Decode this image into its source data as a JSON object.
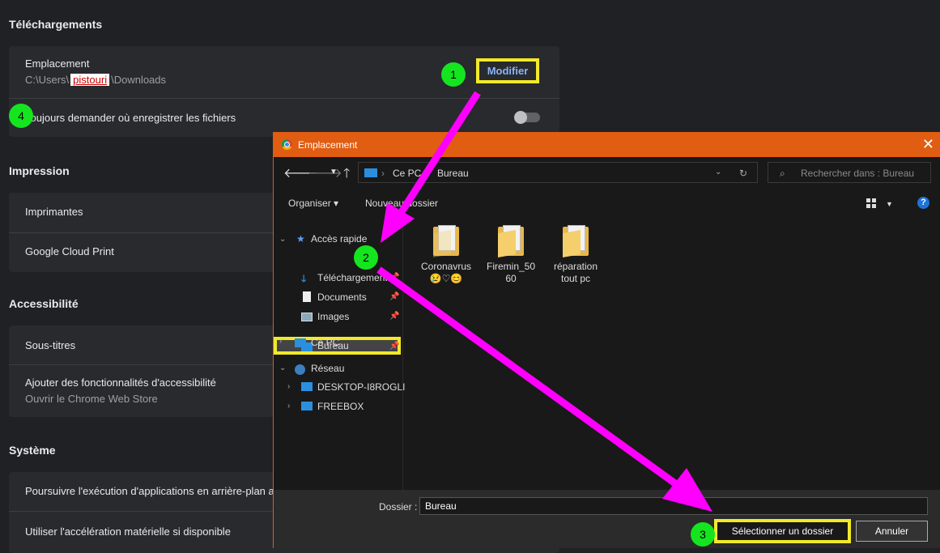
{
  "settings": {
    "downloads": {
      "title": "Téléchargements",
      "location_label": "Emplacement",
      "path_prefix": "C:\\Users\\",
      "path_user": "pistouri",
      "path_suffix": "\\Downloads",
      "modify_button": "Modifier",
      "ask_label": "Toujours demander où enregistrer les fichiers",
      "ask_toggle_on": false
    },
    "printing": {
      "title": "Impression",
      "items": [
        "Imprimantes",
        "Google Cloud Print"
      ]
    },
    "accessibility": {
      "title": "Accessibilité",
      "captions": "Sous-titres",
      "add_features": "Ajouter des fonctionnalités d'accessibilité",
      "add_features_sub": "Ouvrir le Chrome Web Store"
    },
    "system": {
      "title": "Système",
      "background_apps": "Poursuivre l'exécution d'applications en arrière-plan a",
      "hardware_accel": "Utiliser l'accélération matérielle si disponible"
    }
  },
  "dialog": {
    "title": "Emplacement",
    "close": "✕",
    "address": {
      "pc": "Ce PC",
      "sep": "›",
      "current": "Bureau"
    },
    "search_placeholder": "Rechercher dans : Bureau",
    "toolbar": {
      "organize": "Organiser ▾",
      "new_folder": "Nouveau dossier"
    },
    "help": "?",
    "nav": {
      "quick_access": "Accès rapide",
      "quick_items": [
        "Bureau",
        "Téléchargements",
        "Documents",
        "Images"
      ],
      "this_pc": "Ce PC",
      "network": "Réseau",
      "network_items": [
        "DESKTOP-I8ROGLI",
        "FREEBOX"
      ]
    },
    "files": [
      {
        "name1": "Coronavrus",
        "name2": "😢♡😊"
      },
      {
        "name1": "Firemin_50",
        "name2": "60"
      },
      {
        "name1": "réparation",
        "name2": "tout pc"
      }
    ],
    "folder_label": "Dossier :",
    "folder_value": "Bureau",
    "select_button": "Sélectionner un dossier",
    "cancel_button": "Annuler"
  },
  "annotations": {
    "steps": [
      "1",
      "2",
      "3",
      "4"
    ],
    "badge_color": "#14e51f",
    "arrow_color": "#ff00ff",
    "highlight_color": "#f2e92a"
  }
}
